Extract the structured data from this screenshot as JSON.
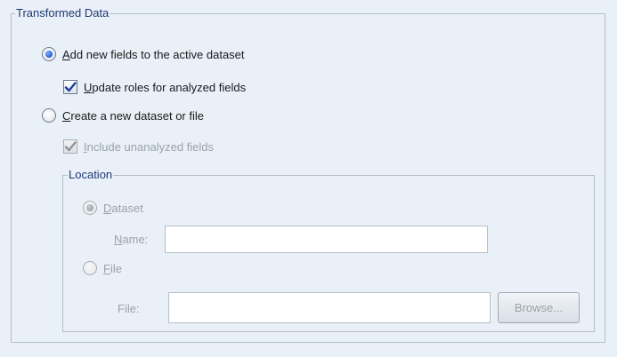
{
  "transformed_group": {
    "title": "Transformed Data",
    "add_fields": {
      "pre": "",
      "mnemonic": "A",
      "post": "dd new fields to the active dataset",
      "checked": true
    },
    "update_roles": {
      "pre": "",
      "mnemonic": "U",
      "post": "pdate roles for analyzed fields",
      "checked": true
    },
    "create_dataset": {
      "pre": "",
      "mnemonic": "C",
      "post": "reate a new dataset or file",
      "checked": false
    },
    "include_unanalyzed": {
      "pre": "",
      "mnemonic": "I",
      "post": "nclude unanalyzed fields",
      "checked": true,
      "disabled": true
    }
  },
  "location_group": {
    "title": "Location",
    "dataset_option": {
      "pre": "",
      "mnemonic": "D",
      "post": "ataset",
      "checked": true,
      "disabled": true
    },
    "name_label": {
      "pre": "",
      "mnemonic": "N",
      "post": "ame:"
    },
    "name_value": "",
    "file_option": {
      "pre": "",
      "mnemonic": "F",
      "post": "ile",
      "checked": false,
      "disabled": true
    },
    "file_label": "File:",
    "file_value": "",
    "browse_label": "Browse..."
  },
  "colors": {
    "panel_bg": "#eaf0f8",
    "group_title": "#1e3a74",
    "disabled_text": "#9aa1aa",
    "radio_accent": "#2f67d8"
  }
}
